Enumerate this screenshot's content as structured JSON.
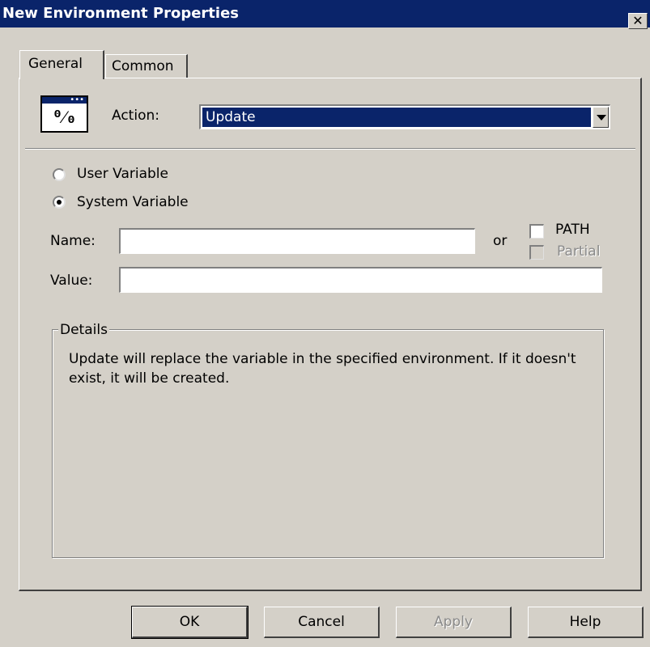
{
  "window": {
    "title": "New Environment Properties",
    "close_label": "✕"
  },
  "tabs": [
    {
      "label": "General",
      "active": true
    },
    {
      "label": "Common",
      "active": false
    }
  ],
  "action_icon": {
    "name": "percent-variable-icon",
    "glyph": "%"
  },
  "action": {
    "label": "Action:",
    "selected": "Update"
  },
  "scope": {
    "options": [
      {
        "label": "User Variable",
        "checked": false
      },
      {
        "label": "System Variable",
        "checked": true
      }
    ]
  },
  "name_field": {
    "label": "Name:",
    "value": "",
    "or_label": "or"
  },
  "path_checkbox": {
    "label": "PATH",
    "checked": false
  },
  "partial_checkbox": {
    "label": "Partial",
    "checked": false,
    "enabled": false
  },
  "value_field": {
    "label": "Value:",
    "value": ""
  },
  "details": {
    "title": "Details",
    "text": "Update will replace the variable in the specified environment. If it doesn't exist, it will be created."
  },
  "buttons": {
    "ok": "OK",
    "cancel": "Cancel",
    "apply": "Apply",
    "help": "Help"
  },
  "colors": {
    "titlebar": "#0a246a",
    "dialog_bg": "#d4d0c8",
    "selection": "#0a246a"
  }
}
